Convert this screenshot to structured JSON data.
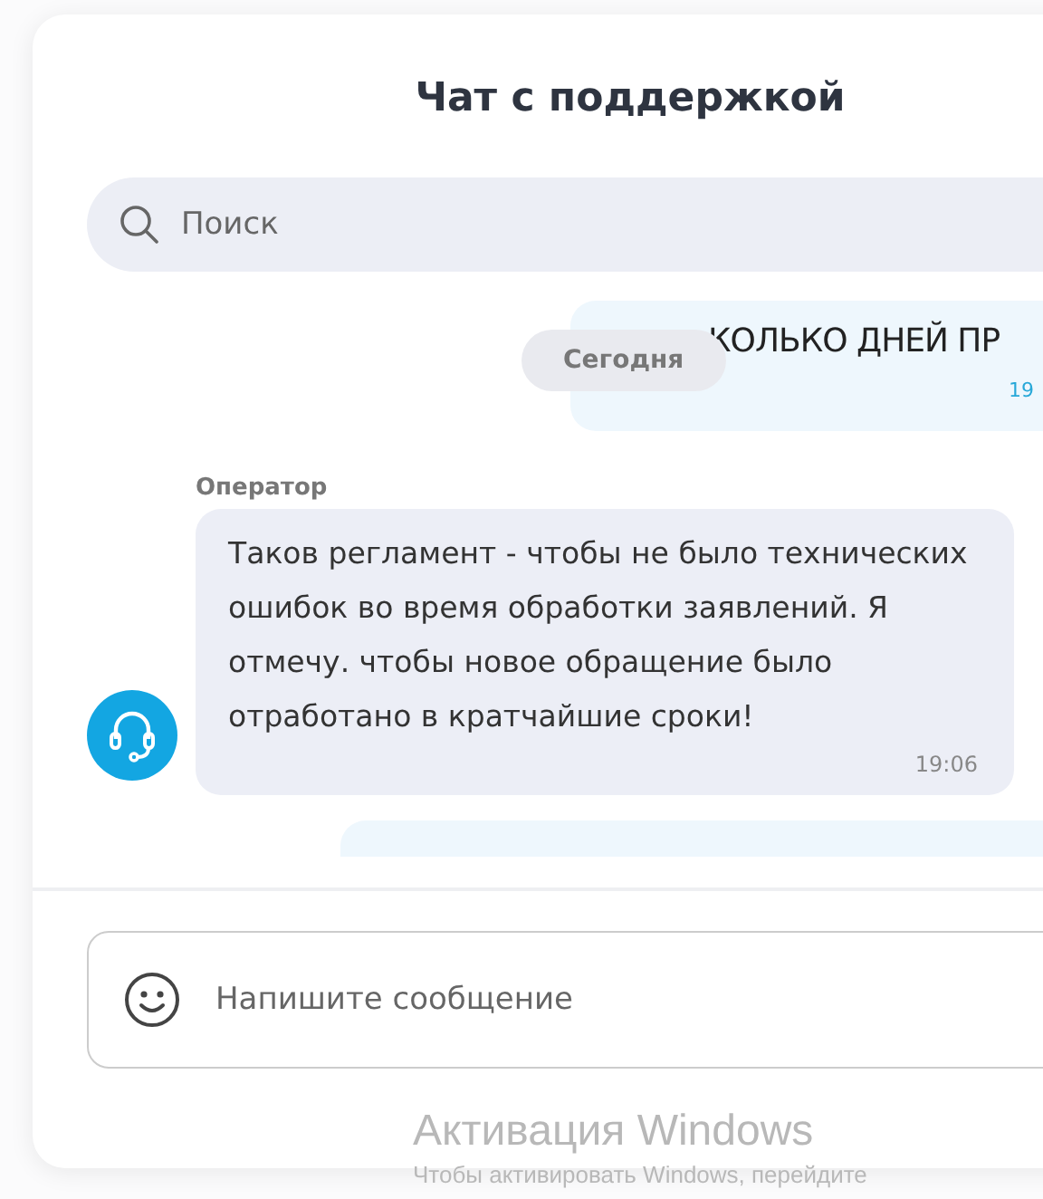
{
  "window": {
    "title": "Чат с поддержкой"
  },
  "search": {
    "placeholder": "Поиск"
  },
  "date_chip": "Сегодня",
  "messages": [
    {
      "kind": "user",
      "text": "КОЛЬКО ДНЕЙ ПР",
      "time": "19"
    },
    {
      "kind": "operator",
      "sender": "Оператор",
      "text": "Таков регламент - чтобы не было технических ошибок во время обработки заявлений. Я отмечу. чтобы новое обращение было отработано в кратчайшие сроки!",
      "time": "19:06"
    },
    {
      "kind": "user"
    }
  ],
  "composer": {
    "placeholder": "Напишите сообщение"
  },
  "os_notice": {
    "title": "Активация Windows",
    "text": "Чтобы активировать Windows, перейдите"
  }
}
